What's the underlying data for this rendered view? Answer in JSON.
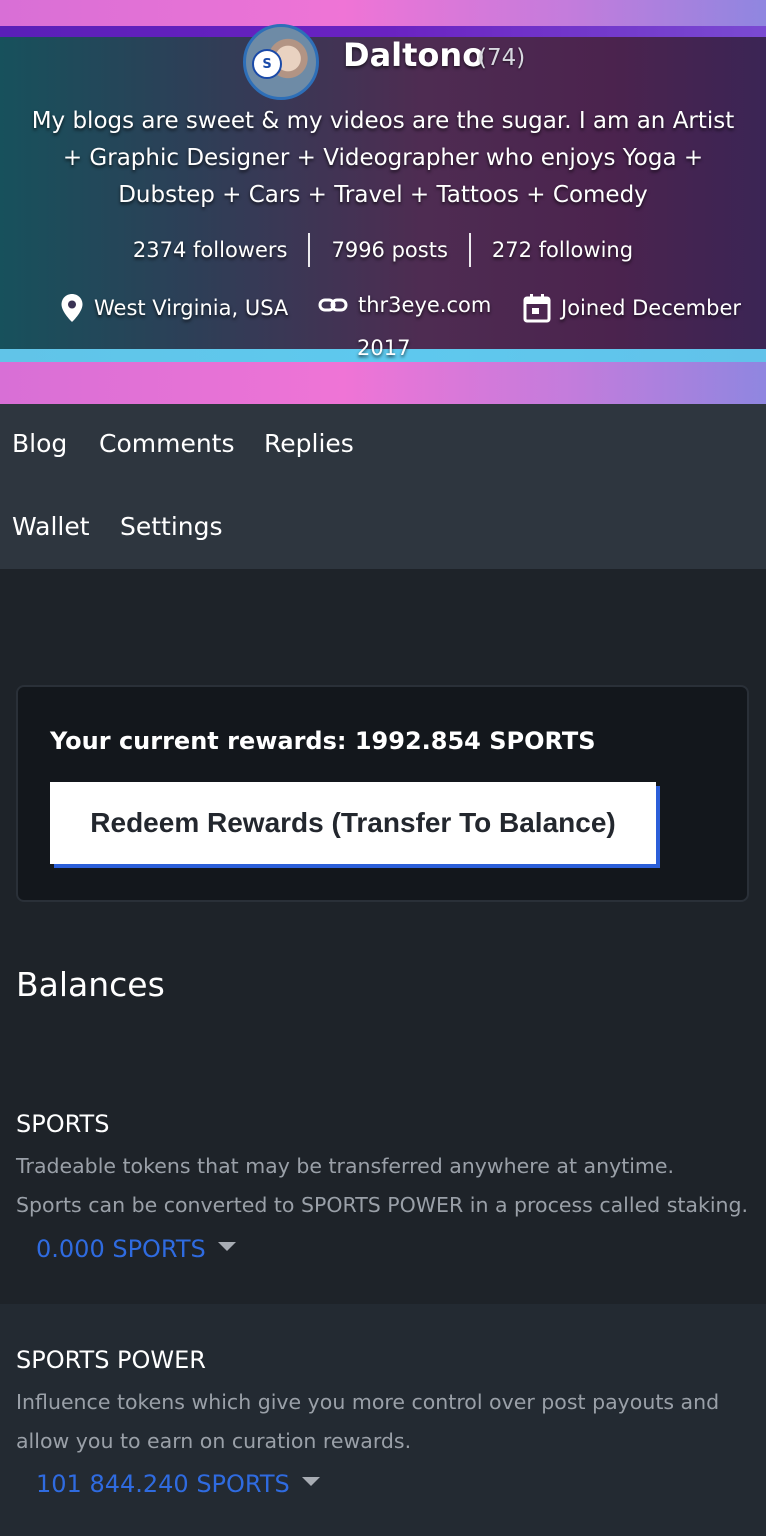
{
  "profile": {
    "name": "Daltono",
    "reputation": "(74)",
    "bio": "My blogs are sweet & my videos are the sugar. I am an Artist + Graphic Designer + Videographer who enjoys Yoga + Dubstep + Cars + Travel + Tattoos + Comedy",
    "stats": {
      "followers": "2374 followers",
      "posts": "7996 posts",
      "following": "272 following"
    },
    "location": "West Virginia, USA",
    "website": "thr3eye.com",
    "joined": "Joined December",
    "joined_year": "2017"
  },
  "nav": {
    "tabs": [
      "Blog",
      "Comments",
      "Replies",
      "Wallet",
      "Settings"
    ]
  },
  "rewards": {
    "text": "Your current rewards: 1992.854 SPORTS",
    "button_label": "Redeem Rewards (Transfer To Balance)"
  },
  "balances": {
    "title": "Balances",
    "sports": {
      "title": "SPORTS",
      "desc_line1": "Tradeable tokens that may be transferred anywhere at anytime.",
      "desc_line2": "Sports can be converted to SPORTS POWER in a process called staking.",
      "amount": "0.000 SPORTS"
    },
    "power": {
      "title": "SPORTS POWER",
      "desc_line1": "Influence tokens which give you more control over post payouts and",
      "desc_line2": "allow you to earn on curation rewards.",
      "amount": "101 844.240 SPORTS"
    }
  },
  "colors": {
    "accent": "#2f6be0",
    "background": "#1e2329",
    "nav": "#2e363f"
  }
}
